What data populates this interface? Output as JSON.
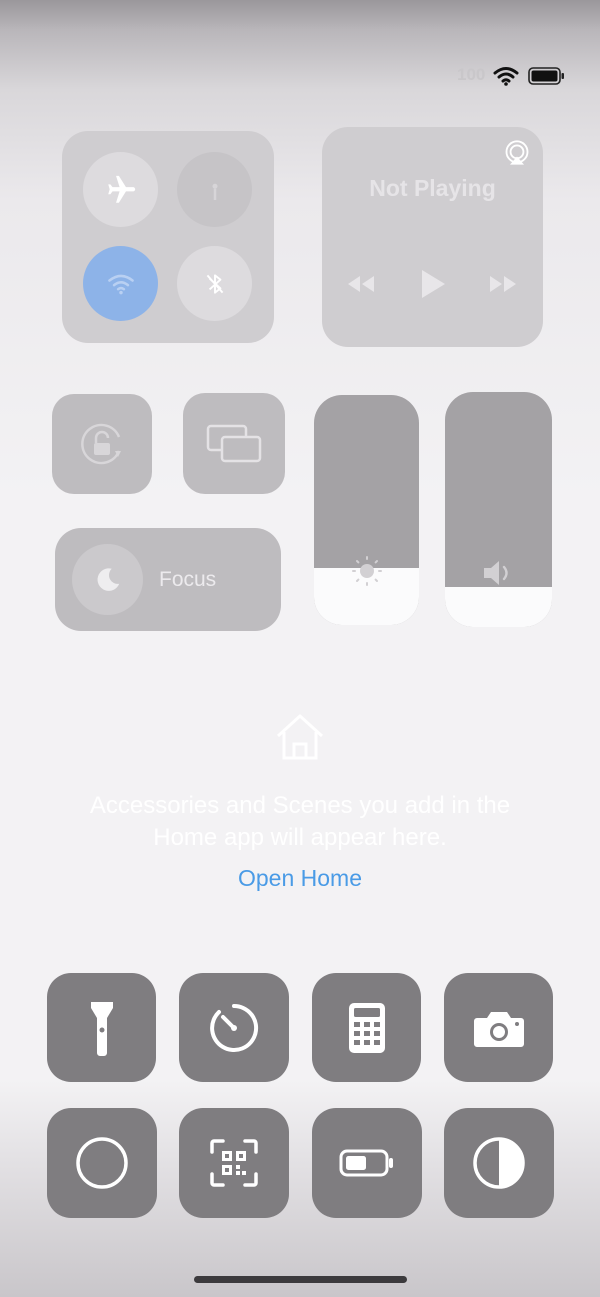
{
  "status_bar": {
    "battery_percent": "100",
    "battery_level": 1.0
  },
  "media": {
    "now_playing": "Not Playing"
  },
  "focus": {
    "label": "Focus"
  },
  "sliders": {
    "brightness_level": 0.25,
    "volume_level": 0.17
  },
  "home": {
    "message_line1": "Accessories and Scenes you add in the",
    "message_line2": "Home app will appear here.",
    "open_home": "Open Home"
  },
  "colors": {
    "accent": "#4a9be6",
    "wifi_active": "#8db3e8",
    "tile_dark": "#7f7d80"
  },
  "controls": [
    {
      "name": "flashlight",
      "icon": "flashlight-icon"
    },
    {
      "name": "timer",
      "icon": "timer-icon"
    },
    {
      "name": "calculator",
      "icon": "calculator-icon"
    },
    {
      "name": "camera",
      "icon": "camera-icon"
    },
    {
      "name": "screen-recording",
      "icon": "record-icon"
    },
    {
      "name": "code-scanner",
      "icon": "qr-code-icon"
    },
    {
      "name": "low-power-mode",
      "icon": "battery-icon"
    },
    {
      "name": "dark-mode",
      "icon": "dark-mode-icon"
    }
  ]
}
